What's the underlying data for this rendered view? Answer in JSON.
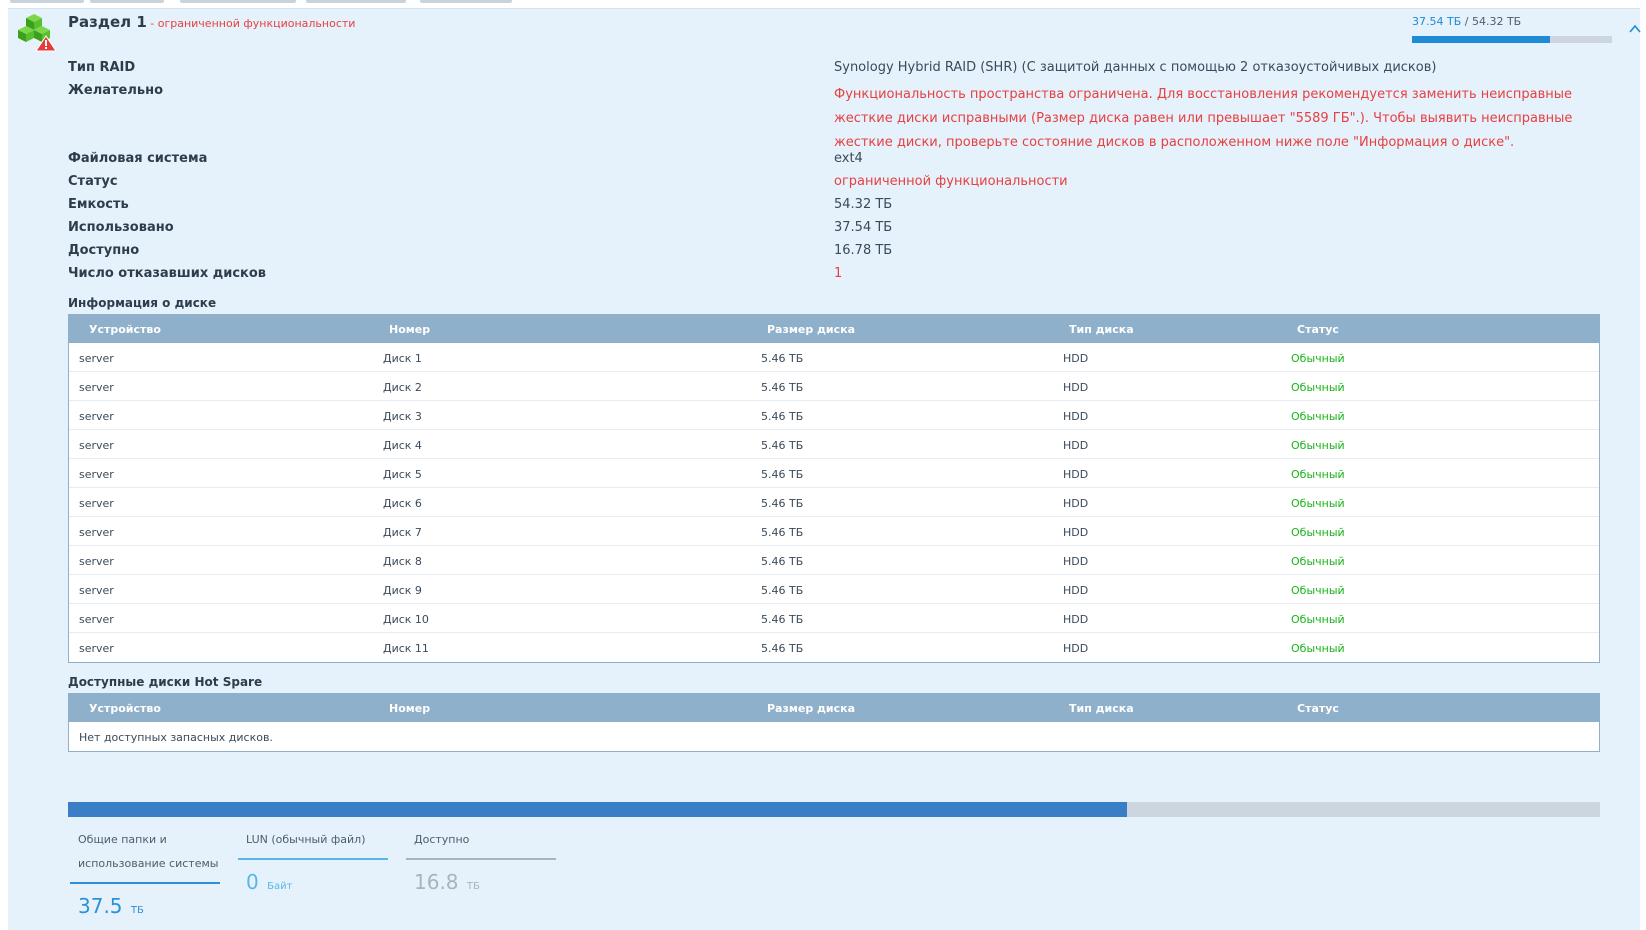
{
  "volume": {
    "title": "Раздел 1",
    "separator": " - ",
    "status_short": "ограниченной функциональности",
    "used": "37.54 ТБ",
    "slash": " / ",
    "total": "54.32 ТБ",
    "usage_ratio": 0.691
  },
  "info": {
    "raid_type_label": "Тип RAID",
    "raid_type_value": "Synology Hybrid RAID (SHR) (С защитой данных с помощью 2 отказоустойчивых дисков)",
    "desired_label": "Желательно",
    "desired_value": "Функциональность пространства ограничена. Для восстановления рекомендуется заменить неисправные жесткие диски исправными (Размер диска равен или превышает \"5589 ГБ\".). Чтобы выявить неисправные жесткие диски, проверьте состояние дисков в расположенном ниже поле \"Информация о диске\".",
    "fs_label": "Файловая система",
    "fs_value": "ext4",
    "status_label": "Статус",
    "status_value": "ограниченной функциональности",
    "capacity_label": "Емкость",
    "capacity_value": "54.32 ТБ",
    "used_label": "Использовано",
    "used_value": "37.54 ТБ",
    "available_label": "Доступно",
    "available_value": "16.78 ТБ",
    "failed_label": "Число отказавших дисков",
    "failed_value": "1"
  },
  "disk_info": {
    "title": "Информация о диске",
    "columns": [
      "Устройство",
      "Номер",
      "Размер диска",
      "Тип диска",
      "Статус"
    ],
    "rows": [
      [
        "server",
        "Диск 1",
        "5.46 ТБ",
        "HDD",
        "Обычный"
      ],
      [
        "server",
        "Диск 2",
        "5.46 ТБ",
        "HDD",
        "Обычный"
      ],
      [
        "server",
        "Диск 3",
        "5.46 ТБ",
        "HDD",
        "Обычный"
      ],
      [
        "server",
        "Диск 4",
        "5.46 ТБ",
        "HDD",
        "Обычный"
      ],
      [
        "server",
        "Диск 5",
        "5.46 ТБ",
        "HDD",
        "Обычный"
      ],
      [
        "server",
        "Диск 6",
        "5.46 ТБ",
        "HDD",
        "Обычный"
      ],
      [
        "server",
        "Диск 7",
        "5.46 ТБ",
        "HDD",
        "Обычный"
      ],
      [
        "server",
        "Диск 8",
        "5.46 ТБ",
        "HDD",
        "Обычный"
      ],
      [
        "server",
        "Диск 9",
        "5.46 ТБ",
        "HDD",
        "Обычный"
      ],
      [
        "server",
        "Диск 10",
        "5.46 ТБ",
        "HDD",
        "Обычный"
      ],
      [
        "server",
        "Диск 11",
        "5.46 ТБ",
        "HDD",
        "Обычный"
      ]
    ]
  },
  "hot_spare": {
    "title": "Доступные диски Hot Spare",
    "columns": [
      "Устройство",
      "Номер",
      "Размер диска",
      "Тип диска",
      "Статус"
    ],
    "empty_text": "Нет доступных запасных дисков."
  },
  "usage": {
    "ratio": 0.691,
    "legend": [
      {
        "label_1": "Общие папки и",
        "label_2": "использование системы",
        "value": "37.5",
        "unit": "ТБ",
        "color": "#2f8fd8"
      },
      {
        "label_1": "",
        "label_2": "LUN (обычный файл)",
        "value": "0",
        "unit": "Байт",
        "color": "#5bb6e8"
      },
      {
        "label_1": "",
        "label_2": "Доступно",
        "value": "16.8",
        "unit": "ТБ",
        "color": "#a9b3bb"
      }
    ]
  },
  "colors": {
    "accent": "#1f8ad6",
    "danger": "#e64040",
    "ok": "#1ab31a",
    "grid_header": "#8fb0cb",
    "panel_bg": "#e5f2fc"
  }
}
